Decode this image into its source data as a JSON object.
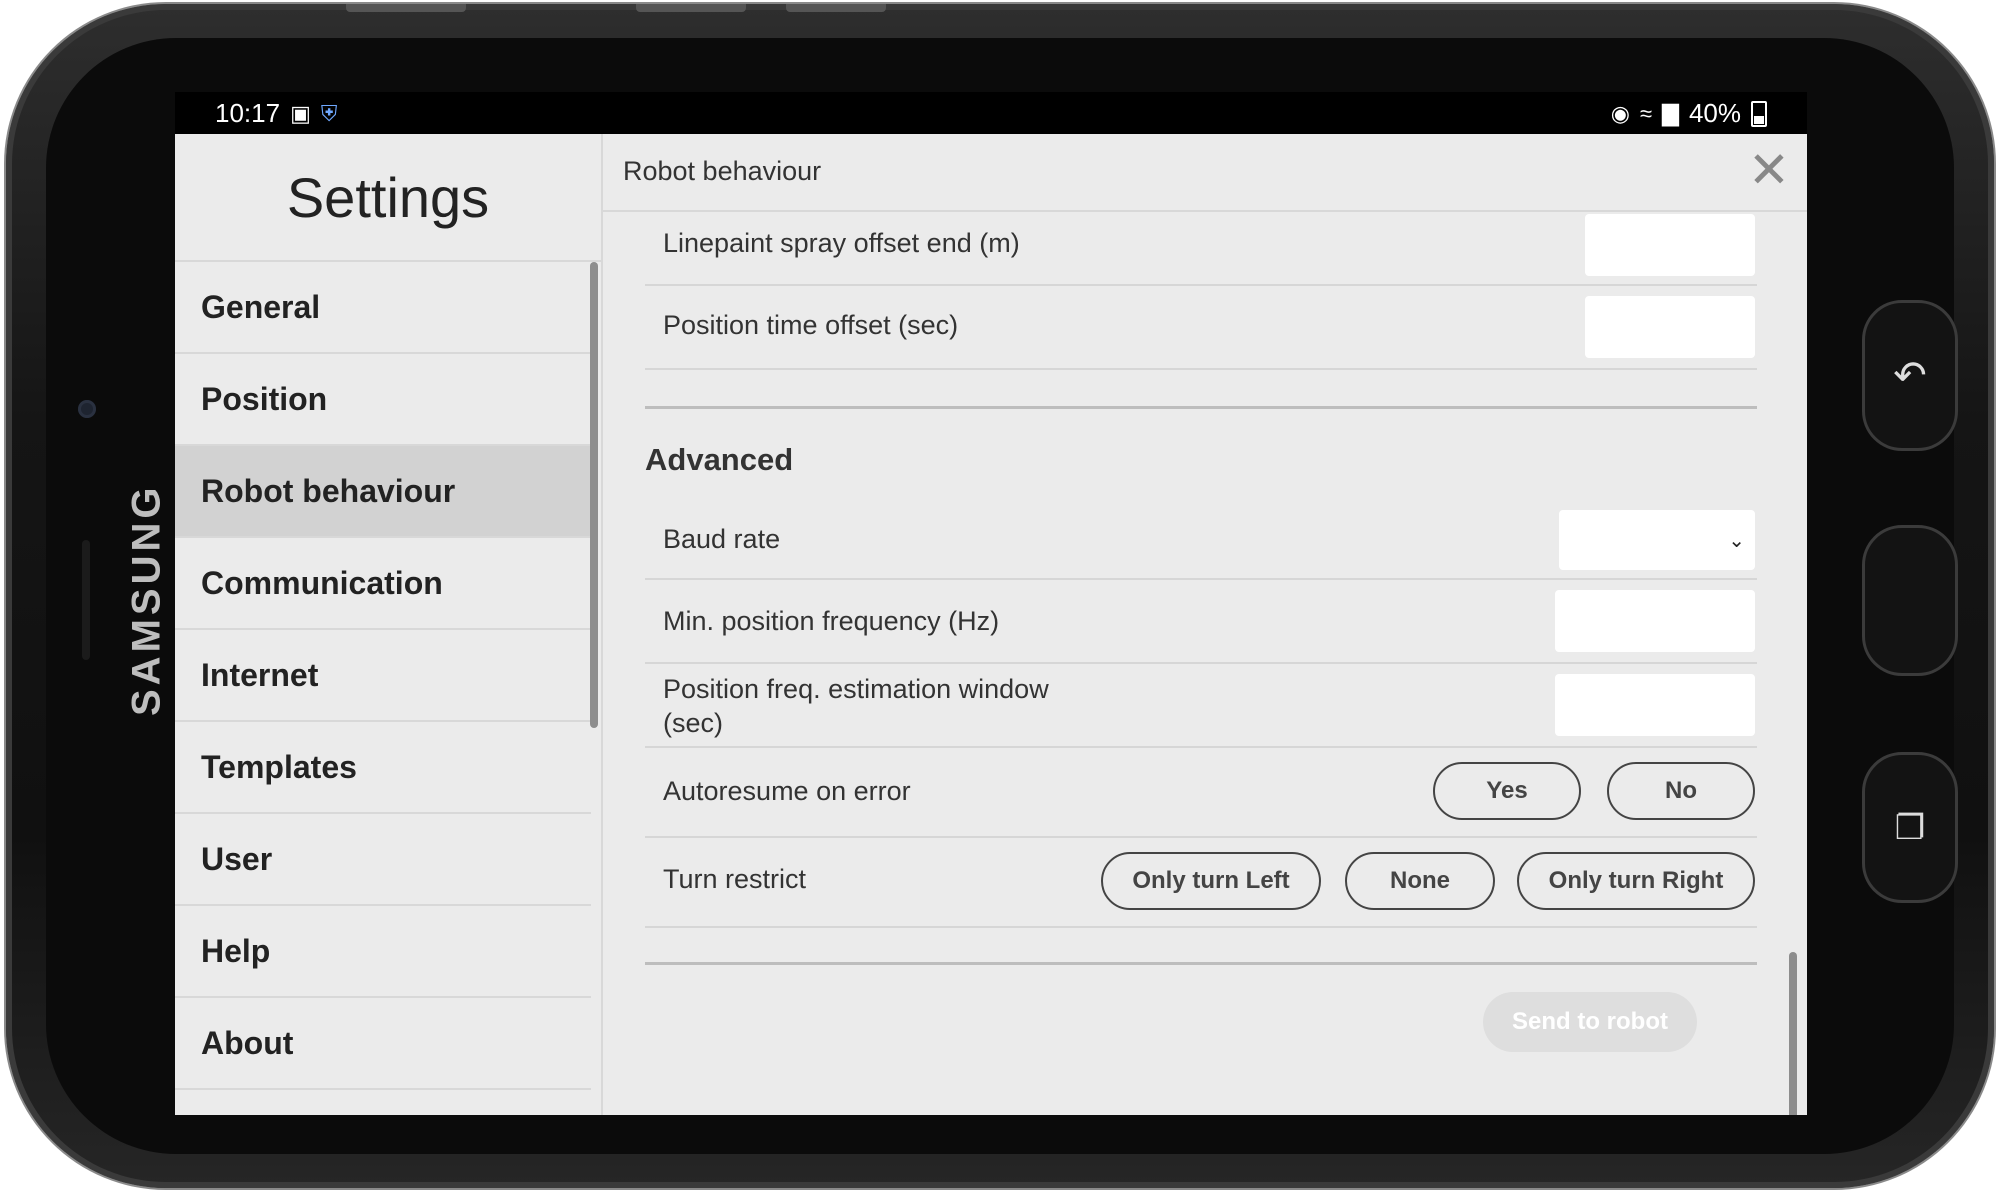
{
  "device": {
    "brand": "SAMSUNG"
  },
  "status_bar": {
    "time": "10:17",
    "battery": "40%"
  },
  "sidebar": {
    "title": "Settings",
    "items": [
      {
        "label": "General",
        "active": false
      },
      {
        "label": "Position",
        "active": false
      },
      {
        "label": "Robot behaviour",
        "active": true
      },
      {
        "label": "Communication",
        "active": false
      },
      {
        "label": "Internet",
        "active": false
      },
      {
        "label": "Templates",
        "active": false
      },
      {
        "label": "User",
        "active": false
      },
      {
        "label": "Help",
        "active": false
      },
      {
        "label": "About",
        "active": false
      }
    ]
  },
  "main": {
    "title": "Robot behaviour",
    "rows_top": [
      {
        "label": "Linepaint spray offset end (m)",
        "value": ""
      },
      {
        "label": "Position time offset (sec)",
        "value": ""
      }
    ],
    "advanced": {
      "title": "Advanced",
      "baud_rate": {
        "label": "Baud rate",
        "value": ""
      },
      "min_freq": {
        "label": "Min. position frequency (Hz)",
        "value": ""
      },
      "freq_window": {
        "label_line1": "Position freq. estimation window",
        "label_line2": "(sec)",
        "value": ""
      },
      "autoresume": {
        "label": "Autoresume on error",
        "options": [
          "Yes",
          "No"
        ]
      },
      "turn_restrict": {
        "label": "Turn restrict",
        "options": [
          "Only turn Left",
          "None",
          "Only turn Right"
        ]
      }
    },
    "send_button": "Send to robot"
  },
  "icons": {
    "close": "close-icon",
    "gallery": "image-icon",
    "shield": "shield-icon",
    "location": "location-icon",
    "wifi": "wifi-icon",
    "signal": "signal-icon",
    "battery": "battery-icon",
    "back": "back-icon",
    "home": "home-icon",
    "recents": "recents-icon",
    "chevron": "chevron-down-icon"
  }
}
